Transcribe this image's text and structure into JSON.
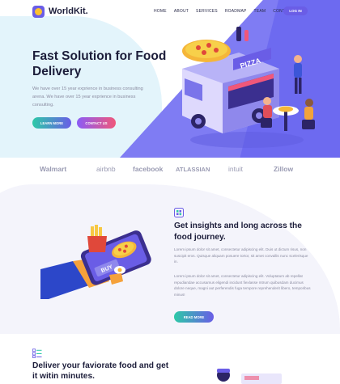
{
  "header": {
    "logo_text": "WorldKit.",
    "nav": [
      "HOME",
      "ABOUT",
      "SERVICES",
      "ROADMAP",
      "TEAM",
      "CONTACT"
    ],
    "login_label": "LOG IN"
  },
  "hero": {
    "title": "Fast Solution for Food Delivery",
    "description": "We have over 15 year exprience in business consulting arena. We have over 15 year exprience in business consulting.",
    "learn_more": "LEARN MORE",
    "contact_us": "CONTACT US",
    "truck_sign": "PIZZA"
  },
  "brands": [
    "Walmart",
    "airbnb",
    "facebook",
    "ATLASSIAN",
    "intuit",
    "Zillow"
  ],
  "insights": {
    "title": "Get insights and long across the food journey.",
    "paragraph1": "Lorem ipsum dolor sit amet, consectetur adipiscing elit. Duis ut dictum risus, non suscipit eros. Quisque aliquam posuere tortor, sit amet convallis nunc scelerisque in.",
    "paragraph2": "Lorem ipsum dolor sit amet, consectetur adipiscing elit. Voluptatum ab repellat repudiandae accusamus eligendi incidunt fiexlasse mtrum quibusdam ducimus dolore neque, magni aut perferendis fuga tempore reprehenderit libero, temporibus minus!",
    "read_more": "READ MORE",
    "phone_label": "BUY"
  },
  "deliver": {
    "title": "Deliver your faviorate food and get it witin minutes."
  },
  "colors": {
    "primary": "#6a5de6",
    "hero_purple": "#7f7cf3",
    "teal": "#2dc9a7",
    "pink": "#f0577a",
    "heading": "#1c1d3a",
    "body_text": "#8a8ba0"
  }
}
